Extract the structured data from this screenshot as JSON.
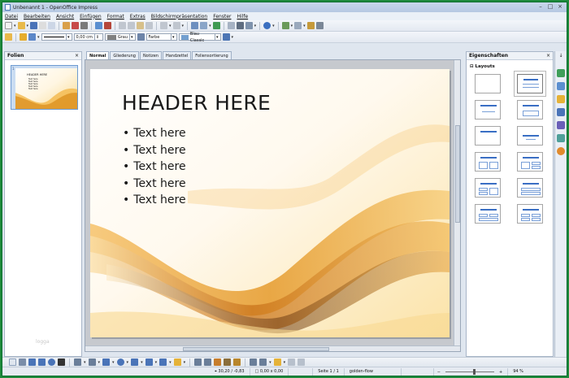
{
  "window": {
    "title": "Unbenannt 1 - OpenOffice Impress"
  },
  "menu": [
    "Datei",
    "Bearbeiten",
    "Ansicht",
    "Einfügen",
    "Format",
    "Extras",
    "Bildschirmpräsentation",
    "Fenster",
    "Hilfe"
  ],
  "toolbar2": {
    "line_width": "0,00 cm",
    "line_color": "Grau",
    "area_style": "Farbe",
    "area_color": "Blau Classic"
  },
  "slides_pane": {
    "title": "Folien",
    "slide_number": "1",
    "watermark": "logga"
  },
  "tabs": [
    "Normal",
    "Gliederung",
    "Notizen",
    "Handzettel",
    "Foliensortierung"
  ],
  "slide": {
    "title": "HEADER HERE",
    "bullets": [
      "Text here",
      "Text here",
      "Text here",
      "Text here",
      "Text here"
    ]
  },
  "thumbnail": {
    "title": "HEADER HERE",
    "bullets": [
      "Text here",
      "Text here",
      "Text here",
      "Text here",
      "Text here"
    ]
  },
  "properties": {
    "title": "Eigenschaften",
    "section": "Layouts"
  },
  "status": {
    "position": "30,20 / -0,83",
    "size": "0,00 x 0,00",
    "page": "Seite 1 / 1",
    "master": "golden-flow",
    "zoom": "94 %",
    "zoom_level": 0.6
  },
  "colors": {
    "window_frame": "#1e8a3c",
    "accent": "#f0a020",
    "selection": "#c9dcf2"
  }
}
